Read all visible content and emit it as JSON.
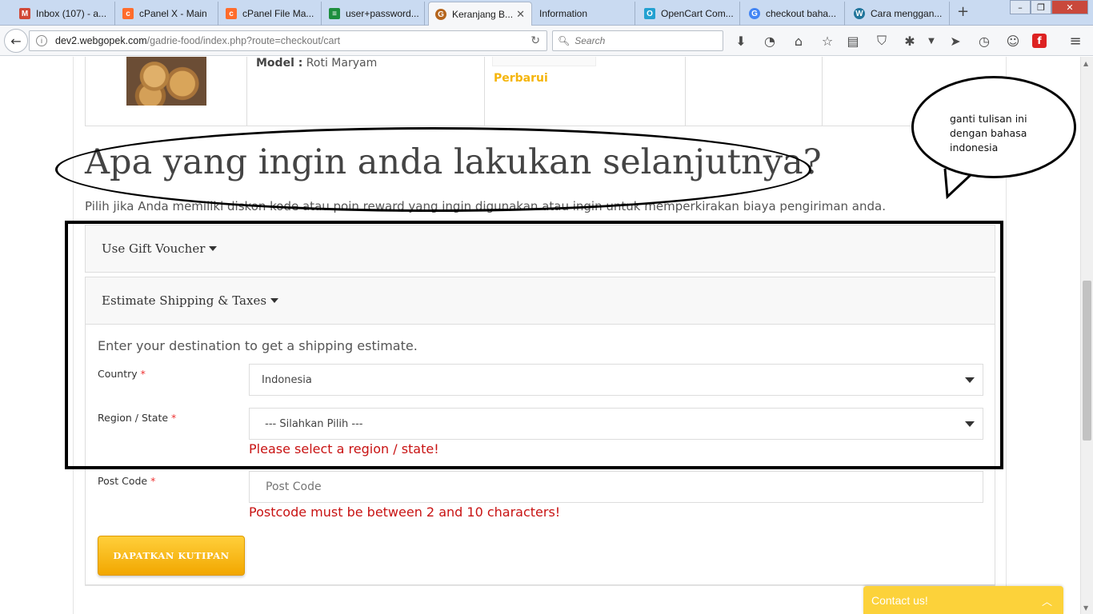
{
  "browser": {
    "tabs": [
      {
        "label": "Inbox (107) - a...",
        "icon": "gmail-icon",
        "color": "#d14836",
        "glyph": "M"
      },
      {
        "label": "cPanel X - Main",
        "icon": "cpanel-icon",
        "color": "#ff6c2c",
        "glyph": "cP"
      },
      {
        "label": "cPanel File Ma...",
        "icon": "cpanel-icon",
        "color": "#ff6c2c",
        "glyph": "cP"
      },
      {
        "label": "user+password...",
        "icon": "sheets-icon",
        "color": "#1e8e3e",
        "glyph": "≡"
      },
      {
        "label": "Keranjang B...",
        "icon": "gadrie-icon",
        "color": "#b5651d",
        "glyph": "G"
      },
      {
        "label": "Information",
        "icon": "",
        "color": "",
        "glyph": ""
      },
      {
        "label": "OpenCart Com...",
        "icon": "opencart-icon",
        "color": "#23a1d1",
        "glyph": "O"
      },
      {
        "label": "checkout baha...",
        "icon": "google-icon",
        "color": "#4285f4",
        "glyph": "G"
      },
      {
        "label": "Cara menggan...",
        "icon": "wordpress-icon",
        "color": "#21759b",
        "glyph": "W"
      }
    ],
    "active_tab": 4,
    "new_tab": "+",
    "url_host": "dev2.webgopek.com",
    "url_path": "/gadrie-food/index.php?route=checkout/cart",
    "search_placeholder": "Search"
  },
  "product": {
    "model_label": "Model :",
    "model_value": "Roti Maryam",
    "update_label": "Perbarui"
  },
  "next": {
    "title": "Apa yang ingin anda lakukan selanjutnya?",
    "subtitle": "Pilih jika Anda memiliki diskon kode atau poin reward yang ingin digunakan atau ingin untuk memperkirakan biaya pengiriman anda."
  },
  "voucher": {
    "heading": "Use Gift Voucher"
  },
  "shipping": {
    "heading": "Estimate Shipping & Taxes",
    "intro": "Enter your destination to get a shipping estimate.",
    "country_label": "Country",
    "country_value": "Indonesia",
    "region_label": "Region / State",
    "region_value": " --- Silahkan Pilih --- ",
    "region_error": "Please select a region / state!",
    "postcode_label": "Post Code",
    "postcode_placeholder": "Post Code",
    "postcode_error": "Postcode must be between 2 and 10 characters!",
    "required_mark": "*",
    "quote_button": "DAPATKAN KUTIPAN"
  },
  "annotation": {
    "bubble_text": "ganti tulisan ini dengan bahasa indonesia"
  },
  "contact": {
    "label": "Contact us!"
  }
}
